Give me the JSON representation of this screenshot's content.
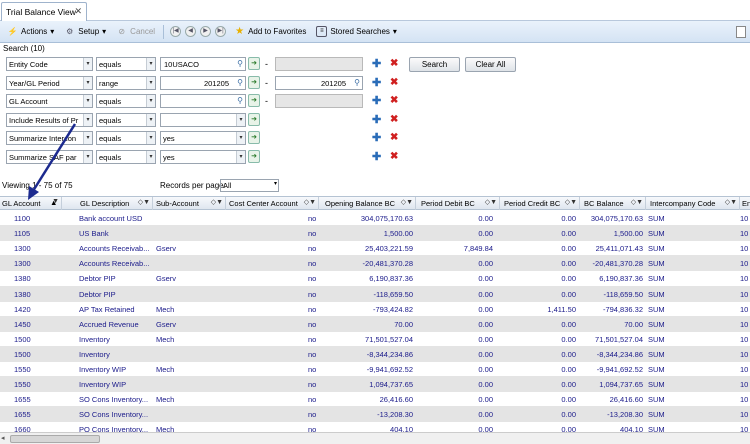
{
  "tab": {
    "title": "Trial Balance View"
  },
  "toolbar": {
    "actions": "Actions",
    "setup": "Setup",
    "cancel": "Cancel",
    "favorites": "Add to Favorites",
    "stored": "Stored Searches"
  },
  "search": {
    "label": "Search (10)",
    "search_button": "Search",
    "clear_button": "Clear All",
    "rows": [
      {
        "field": "Entity Code",
        "op": "equals",
        "value": "10USACO",
        "value2": ""
      },
      {
        "field": "Year/GL Period",
        "op": "range",
        "value": "201205",
        "value2": "201205"
      },
      {
        "field": "GL Account",
        "op": "equals",
        "value": "",
        "value2": ""
      },
      {
        "field": "Include Results of Pr",
        "op": "equals",
        "value": "",
        "value2": ""
      },
      {
        "field": "Summarize Intercon",
        "op": "equals",
        "value": "yes",
        "value2": ""
      },
      {
        "field": "Summarize SAF par",
        "op": "equals",
        "value": "yes",
        "value2": ""
      }
    ]
  },
  "paging": {
    "viewing": "Viewing 1 - 75 of 75",
    "rpp_label": "Records per page:",
    "rpp_value": "All"
  },
  "grid": {
    "columns": [
      "GL Account",
      "GL Description",
      "Sub-Account",
      "Cost Center Account",
      "Opening Balance BC",
      "Period Debit BC",
      "Period Credit BC",
      "BC Balance",
      "Intercompany Code",
      "En"
    ],
    "rows": [
      [
        "1100",
        "Bank account USD",
        "",
        "no",
        "304,075,170.63",
        "0.00",
        "0.00",
        "304,075,170.63",
        "SUM",
        "10"
      ],
      [
        "1105",
        "US Bank",
        "",
        "no",
        "1,500.00",
        "0.00",
        "0.00",
        "1,500.00",
        "SUM",
        "10"
      ],
      [
        "1300",
        "Accounts Receivab...",
        "Gserv",
        "no",
        "25,403,221.59",
        "7,849.84",
        "0.00",
        "25,411,071.43",
        "SUM",
        "10"
      ],
      [
        "1300",
        "Accounts Receivab...",
        "",
        "no",
        "-20,481,370.28",
        "0.00",
        "0.00",
        "-20,481,370.28",
        "SUM",
        "10"
      ],
      [
        "1380",
        "Debtor PIP",
        "Gserv",
        "no",
        "6,190,837.36",
        "0.00",
        "0.00",
        "6,190,837.36",
        "SUM",
        "10"
      ],
      [
        "1380",
        "Debtor PIP",
        "",
        "no",
        "-118,659.50",
        "0.00",
        "0.00",
        "-118,659.50",
        "SUM",
        "10"
      ],
      [
        "1420",
        "AP Tax Retained",
        "Mech",
        "no",
        "-793,424.82",
        "0.00",
        "1,411.50",
        "-794,836.32",
        "SUM",
        "10"
      ],
      [
        "1450",
        "Accrued Revenue",
        "Gserv",
        "no",
        "70.00",
        "0.00",
        "0.00",
        "70.00",
        "SUM",
        "10"
      ],
      [
        "1500",
        "Inventory",
        "Mech",
        "no",
        "71,501,527.04",
        "0.00",
        "0.00",
        "71,501,527.04",
        "SUM",
        "10"
      ],
      [
        "1500",
        "Inventory",
        "",
        "no",
        "-8,344,234.86",
        "0.00",
        "0.00",
        "-8,344,234.86",
        "SUM",
        "10"
      ],
      [
        "1550",
        "Inventory WIP",
        "Mech",
        "no",
        "-9,941,692.52",
        "0.00",
        "0.00",
        "-9,941,692.52",
        "SUM",
        "10"
      ],
      [
        "1550",
        "Inventory WIP",
        "",
        "no",
        "1,094,737.65",
        "0.00",
        "0.00",
        "1,094,737.65",
        "SUM",
        "10"
      ],
      [
        "1655",
        "SO Cons Inventory...",
        "Mech",
        "no",
        "26,416.60",
        "0.00",
        "0.00",
        "26,416.60",
        "SUM",
        "10"
      ],
      [
        "1655",
        "SO Cons Inventory...",
        "",
        "no",
        "-13,208.30",
        "0.00",
        "0.00",
        "-13,208.30",
        "SUM",
        "10"
      ],
      [
        "1660",
        "PO Cons Inventory...",
        "Mech",
        "no",
        "404.10",
        "0.00",
        "0.00",
        "404.10",
        "SUM",
        "10"
      ]
    ]
  },
  "colors": {
    "link": "#1a1a8a",
    "alt_row": "#e4e4e4",
    "toolbar": "#d4e3f4",
    "arrow": "#1c2a8f"
  }
}
